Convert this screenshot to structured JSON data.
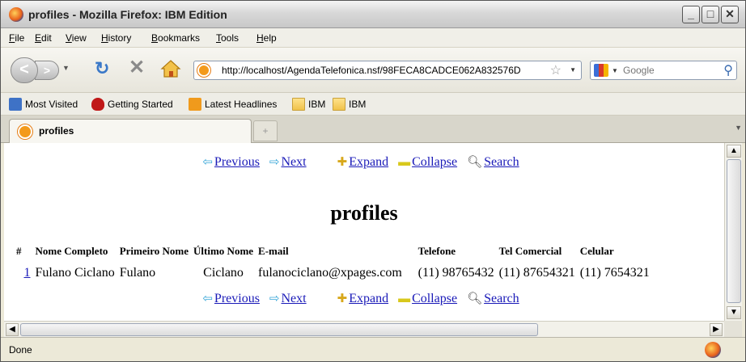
{
  "window": {
    "title": "profiles - Mozilla Firefox: IBM Edition"
  },
  "menu": [
    "File",
    "Edit",
    "View",
    "History",
    "Bookmarks",
    "Tools",
    "Help"
  ],
  "nav": {
    "url": "http://localhost/AgendaTelefonica.nsf/98FECA8CADCE062A832576D",
    "search_placeholder": "Google"
  },
  "bookmarks": [
    "Most Visited",
    "Getting Started",
    "Latest Headlines",
    "IBM",
    "IBM"
  ],
  "tab": {
    "label": "profiles"
  },
  "page": {
    "title": "profiles",
    "pager": {
      "previous": "Previous",
      "next": "Next",
      "expand": "Expand",
      "collapse": "Collapse",
      "search": "Search"
    },
    "columns": [
      "#",
      "Nome Completo",
      "Primeiro Nome",
      "Último Nome",
      "E-mail",
      "Telefone",
      "Tel Comercial",
      "Celular"
    ],
    "rows": [
      [
        "1",
        "Fulano Ciclano",
        "Fulano",
        "Ciclano",
        "fulanociclano@xpages.com",
        "(11) 98765432",
        "(11) 87654321",
        "(11) 7654321"
      ]
    ]
  },
  "status": {
    "text": "Done"
  }
}
